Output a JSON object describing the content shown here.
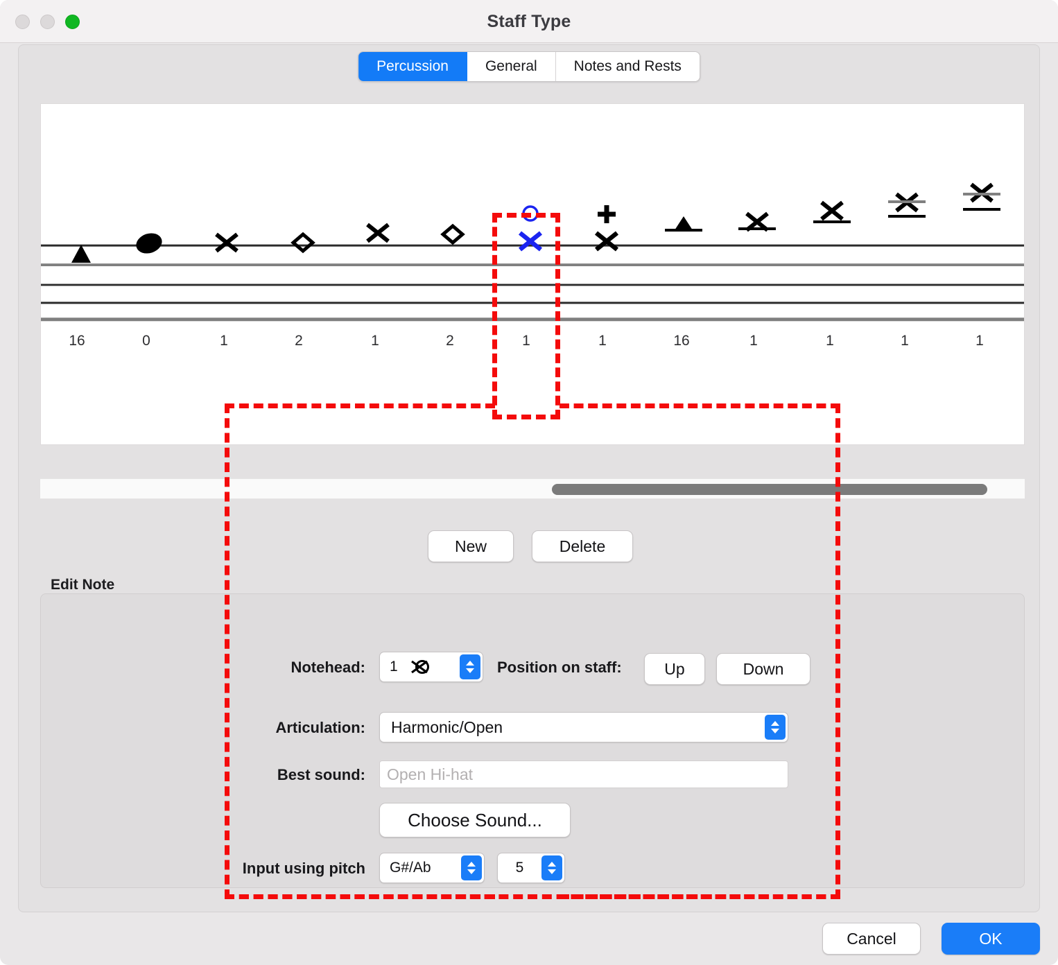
{
  "window": {
    "title": "Staff Type",
    "traffic_lights": [
      {
        "name": "close",
        "color": "#dcd9da",
        "enabled": false
      },
      {
        "name": "minimize",
        "color": "#dcd9da",
        "enabled": false
      },
      {
        "name": "zoom",
        "color": "#10b722",
        "enabled": true
      }
    ]
  },
  "tabs": [
    {
      "label": "Percussion",
      "active": true
    },
    {
      "label": "General",
      "active": false
    },
    {
      "label": "Notes and Rests",
      "active": false
    }
  ],
  "staff_preview": {
    "selected_index": 6,
    "selection_color": "#1b24f0",
    "notes": [
      {
        "index": 0,
        "number": "16",
        "glyph": "triangle-up-filled",
        "position": "below-line",
        "articulation": "",
        "ledger": false,
        "selected": false
      },
      {
        "index": 1,
        "number": "0",
        "glyph": "oval-filled",
        "position": "on-line",
        "articulation": "",
        "ledger": false,
        "selected": false
      },
      {
        "index": 2,
        "number": "1",
        "glyph": "x-notehead",
        "position": "on-line",
        "articulation": "",
        "ledger": false,
        "selected": false
      },
      {
        "index": 3,
        "number": "2",
        "glyph": "diamond-notehead",
        "position": "on-line",
        "articulation": "",
        "ledger": false,
        "selected": false
      },
      {
        "index": 4,
        "number": "1",
        "glyph": "x-notehead",
        "position": "above-line",
        "articulation": "",
        "ledger": false,
        "selected": false
      },
      {
        "index": 5,
        "number": "2",
        "glyph": "diamond-notehead",
        "position": "above-line",
        "articulation": "",
        "ledger": false,
        "selected": false
      },
      {
        "index": 6,
        "number": "1",
        "glyph": "x-notehead",
        "position": "on-line",
        "articulation": "circle-open",
        "ledger": false,
        "selected": true
      },
      {
        "index": 7,
        "number": "1",
        "glyph": "x-notehead",
        "position": "on-line",
        "articulation": "plus-closed",
        "ledger": false,
        "selected": false
      },
      {
        "index": 8,
        "number": "16",
        "glyph": "triangle-up-filled",
        "position": "above-staff",
        "articulation": "",
        "ledger": true,
        "selected": false
      },
      {
        "index": 9,
        "number": "1",
        "glyph": "x-notehead",
        "position": "above-staff",
        "articulation": "",
        "ledger": true,
        "selected": false
      },
      {
        "index": 10,
        "number": "1",
        "glyph": "x-notehead",
        "position": "above-staff",
        "articulation": "",
        "ledger": true,
        "selected": false
      },
      {
        "index": 11,
        "number": "1",
        "glyph": "x-notehead",
        "position": "above-staff",
        "articulation": "",
        "ledger": true,
        "selected": false
      },
      {
        "index": 12,
        "number": "1",
        "glyph": "x-notehead",
        "position": "above-staff",
        "articulation": "",
        "ledger": true,
        "selected": false
      }
    ]
  },
  "scrollbar": {
    "orientation": "horizontal",
    "thumb_start_pct": 52,
    "thumb_width_pct": 44
  },
  "actions": {
    "new_label": "New",
    "delete_label": "Delete"
  },
  "edit_note": {
    "group_label": "Edit Note",
    "notehead": {
      "label": "Notehead:",
      "value": "1",
      "glyph_name": "x-circle-notehead-icon"
    },
    "position_on_staff": {
      "label": "Position on staff:",
      "up_label": "Up",
      "down_label": "Down"
    },
    "articulation": {
      "label": "Articulation:",
      "value": "Harmonic/Open"
    },
    "best_sound": {
      "label": "Best sound:",
      "placeholder": "Open Hi-hat",
      "value": ""
    },
    "choose_sound_label": "Choose Sound...",
    "input_using_pitch": {
      "label": "Input using pitch",
      "pitch_value": "G#/Ab",
      "octave_value": "5"
    }
  },
  "footer": {
    "cancel_label": "Cancel",
    "ok_label": "OK"
  },
  "annotations": {
    "highlight_color": "#f40b0b",
    "boxes": [
      {
        "name": "selected-note-highlight"
      },
      {
        "name": "edit-note-fields-highlight"
      }
    ]
  }
}
